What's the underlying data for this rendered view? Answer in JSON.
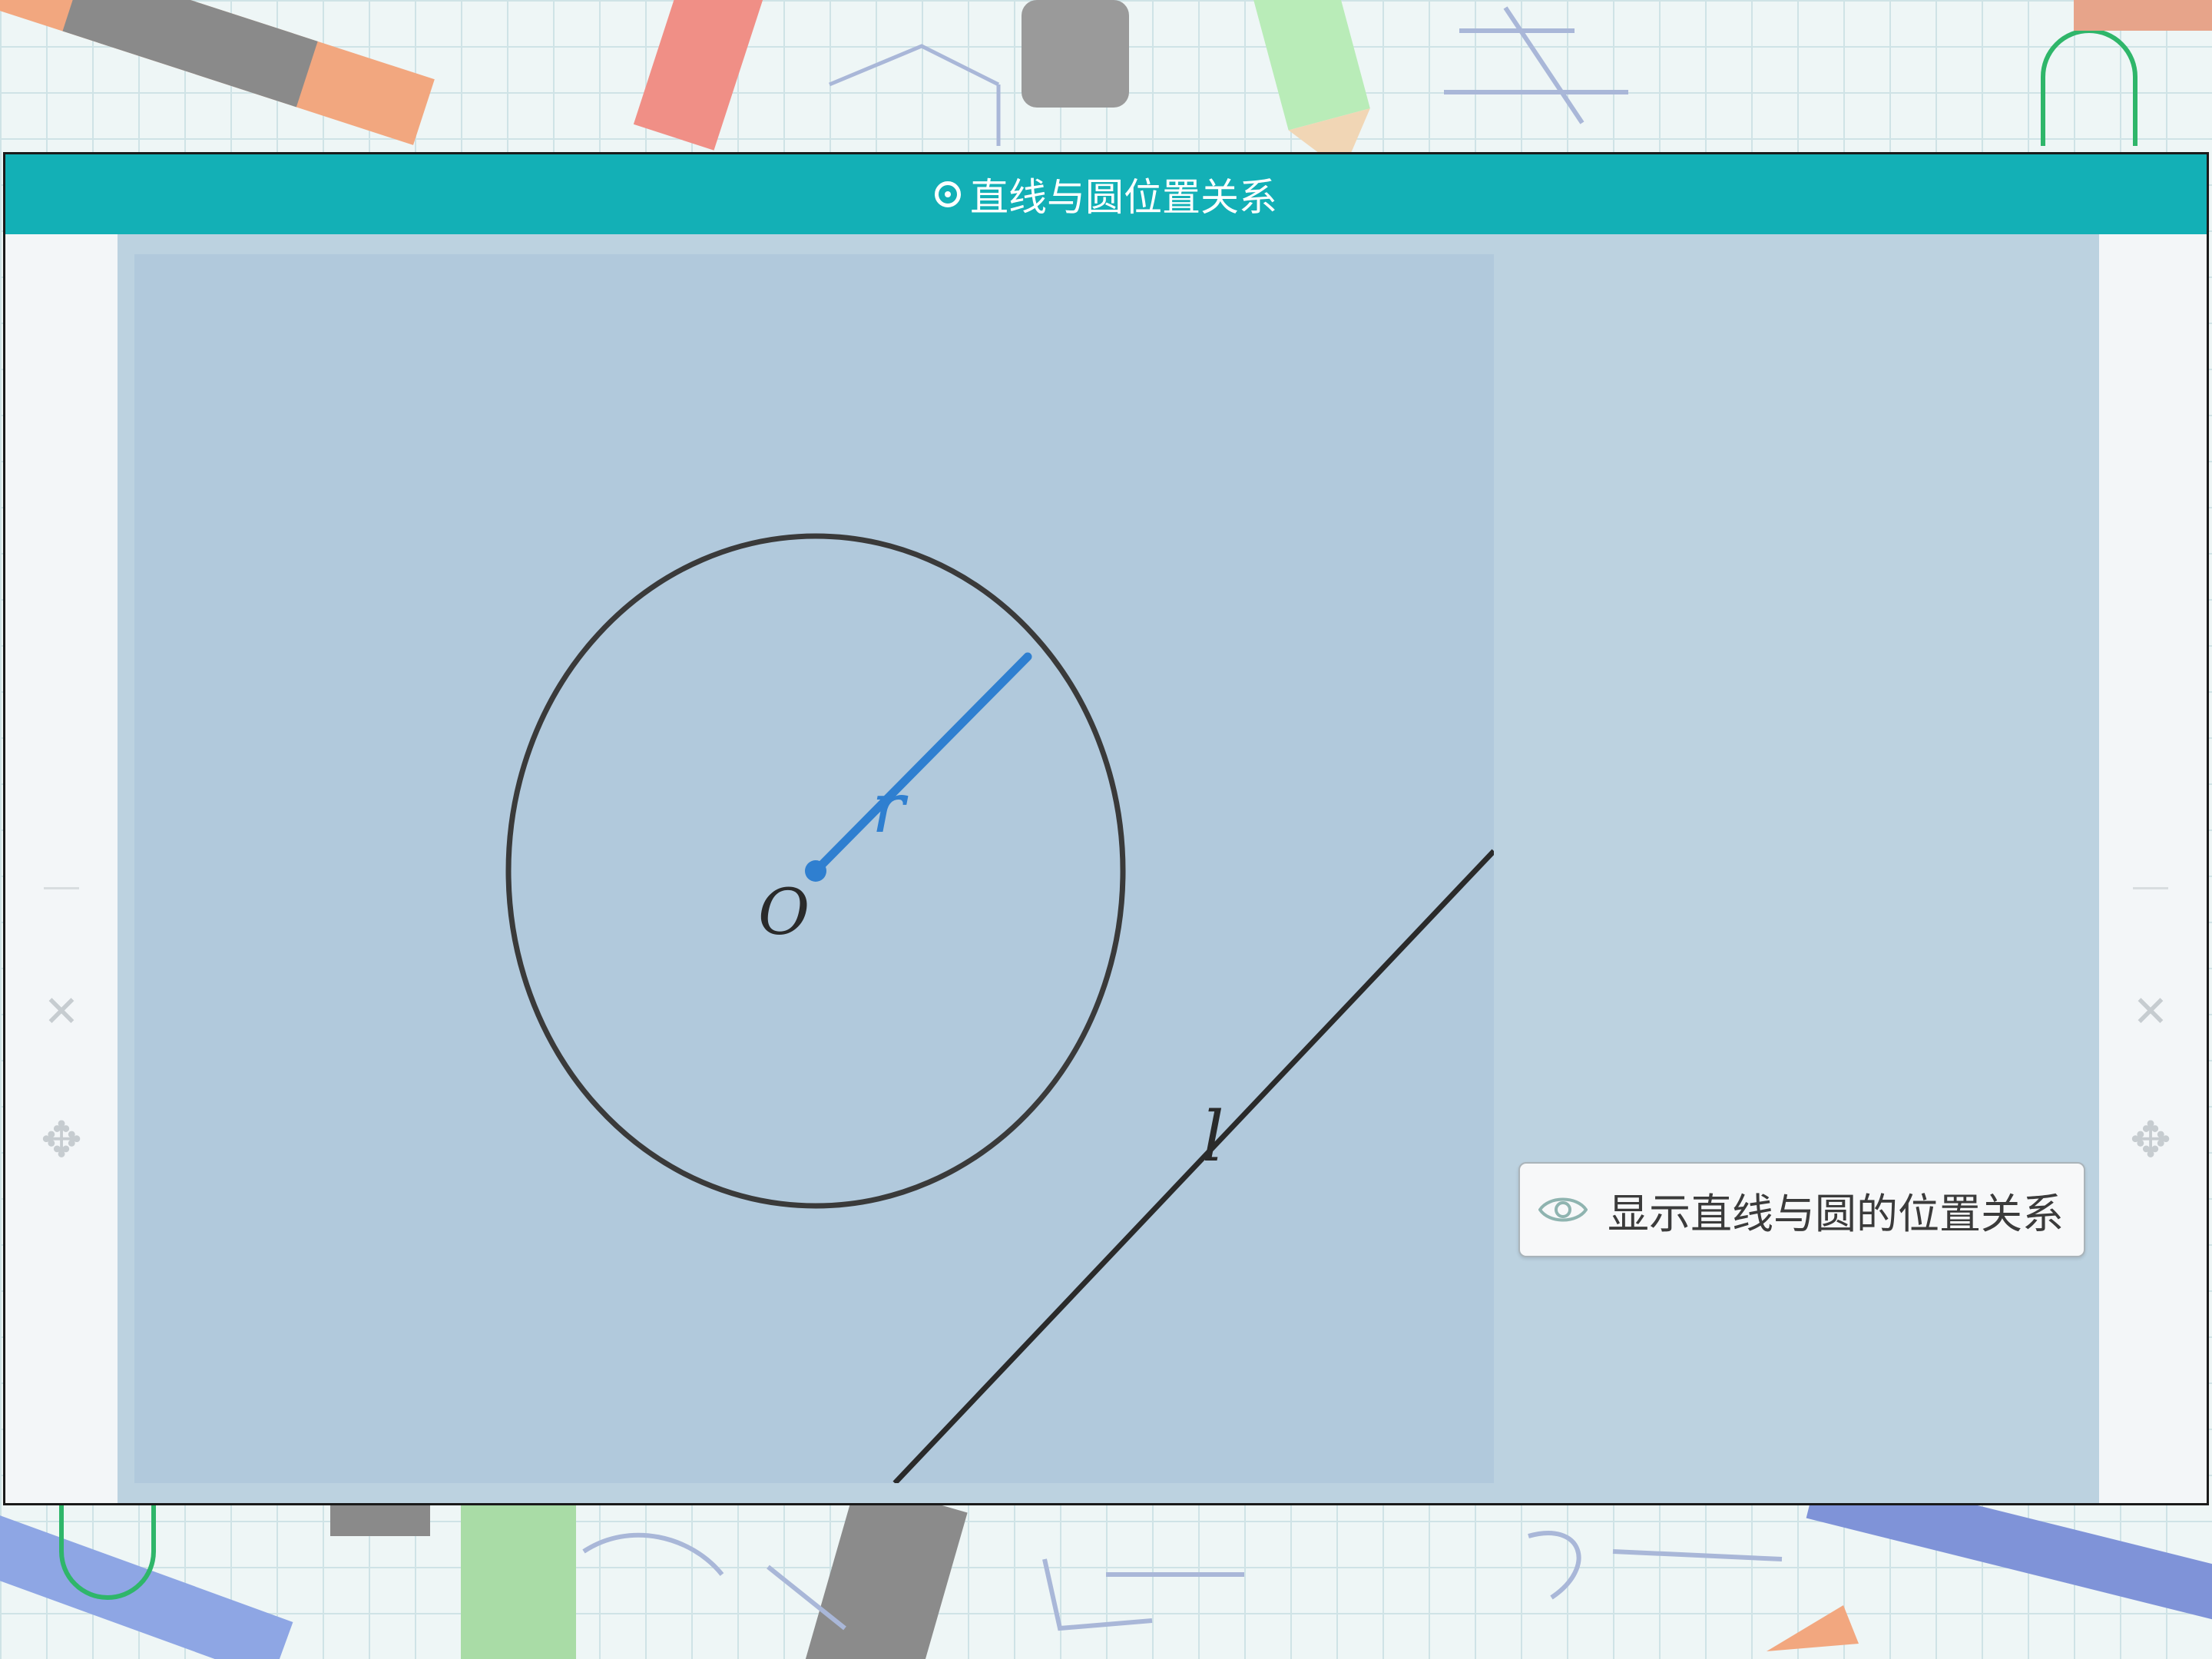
{
  "window": {
    "title": "直线与圆位置关系",
    "title_icon": "circle-dot-icon"
  },
  "side_controls": {
    "minimize_icon": "dash-icon",
    "close_icon": "close-icon",
    "move_icon": "move-icon"
  },
  "figure": {
    "center_label": "O",
    "radius_label": "r",
    "line_label": "l",
    "circle_color": "#3a3a3a",
    "radius_color": "#2f7fd0",
    "line_color": "#2a2a2a"
  },
  "actions": {
    "show_relation_label": "显示直线与圆的位置关系",
    "show_relation_icon": "eye-icon"
  },
  "colors": {
    "titlebar": "#13b0b6",
    "canvas": "#b1c9dc",
    "panel": "#bcd2e0"
  }
}
